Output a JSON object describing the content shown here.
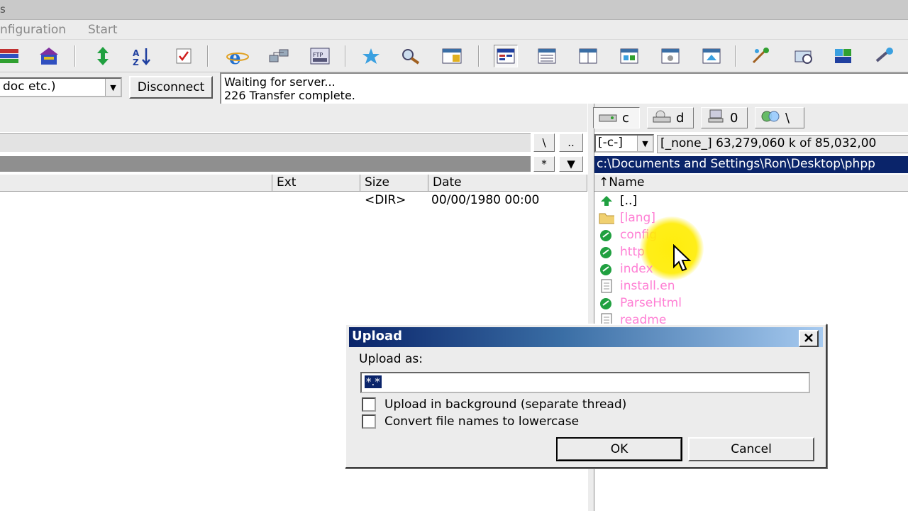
{
  "window": {
    "title_fragment": "s"
  },
  "menu": {
    "items": [
      "nfiguration",
      "Start"
    ]
  },
  "connection": {
    "transfer_mode": "doc etc.)",
    "disconnect_label": "Disconnect",
    "log": [
      "Waiting for server...",
      "226 Transfer complete."
    ]
  },
  "left_panel": {
    "root_button": "\\",
    "up_button": "..",
    "star_button": "*",
    "columns": {
      "ext": "Ext",
      "size": "Size",
      "date": "Date"
    },
    "rows": [
      {
        "size": "<DIR>",
        "date": "00/00/1980 00:00"
      }
    ]
  },
  "right_panel": {
    "drives": [
      {
        "letter": "c",
        "icon": "local-drive-icon"
      },
      {
        "letter": "d",
        "icon": "cd-drive-icon"
      },
      {
        "letter": "0",
        "icon": "network-drive-icon"
      },
      {
        "letter": "\\",
        "icon": "network-neighborhood-icon"
      }
    ],
    "drive_select": "[-c-]",
    "drive_info": "[_none_]  63,279,060 k of 85,032,00",
    "path": "c:\\Documents and Settings\\Ron\\Desktop\\phpp",
    "name_header": "↑Name",
    "files": [
      {
        "name": "[..]",
        "icon": "up-arrow-icon"
      },
      {
        "name": "[lang]",
        "icon": "folder-icon"
      },
      {
        "name": "config",
        "icon": "php-file-icon"
      },
      {
        "name": "http",
        "icon": "php-file-icon"
      },
      {
        "name": "index",
        "icon": "php-file-icon"
      },
      {
        "name": "install.en",
        "icon": "text-file-icon"
      },
      {
        "name": "ParseHtml",
        "icon": "php-file-icon"
      },
      {
        "name": "readme",
        "icon": "text-file-icon"
      }
    ]
  },
  "dialog": {
    "title": "Upload",
    "upload_as_label": "Upload as:",
    "upload_as_value": "*.*",
    "option_background": "Upload in background (separate thread)",
    "option_lowercase": "Convert file names to lowercase",
    "ok_label": "OK",
    "cancel_label": "Cancel"
  },
  "colors": {
    "selection": "#0a246a",
    "file_text": "#ff7fd4",
    "highlight": "#ffec00"
  }
}
